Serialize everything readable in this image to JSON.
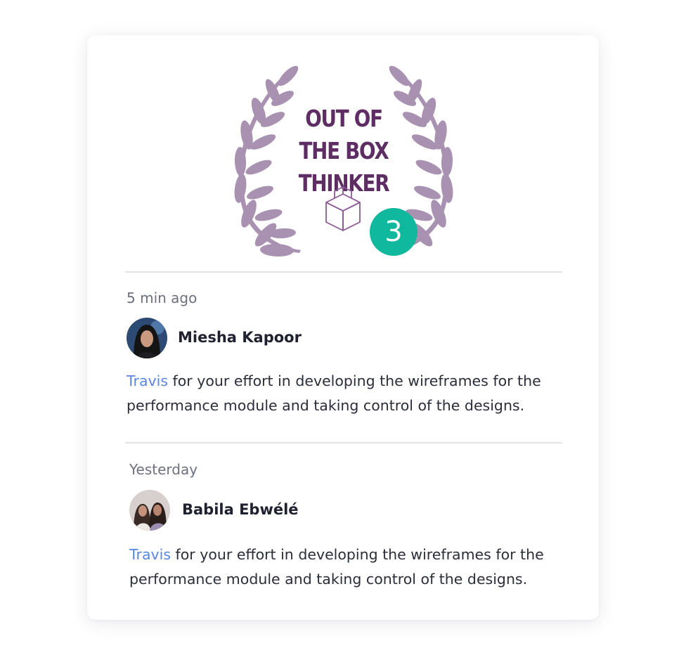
{
  "award": {
    "title_lines": [
      "OUT OF",
      "THE BOX",
      "THINKER"
    ],
    "count": "3",
    "colors": {
      "laurel": "#a991b1",
      "title": "#5e2d63",
      "count_bg": "#10b89d"
    },
    "icon": "box-icon"
  },
  "feed": [
    {
      "time": "5 min ago",
      "author": "Miesha Kapoor",
      "mention": "Travis",
      "line1": " for your effort in developing the wireframes for the",
      "line2": "performance module and taking control of the designs."
    },
    {
      "time": "Yesterday",
      "author": "Babila Ebwélé",
      "mention": "Travis",
      "line1": " for your effort in developing the wireframes for the",
      "line2": "performance module and taking control of the designs."
    }
  ],
  "colors": {
    "mention": "#5a86e0",
    "divider": "#e3e3e6",
    "muted_text": "#6e7080"
  }
}
